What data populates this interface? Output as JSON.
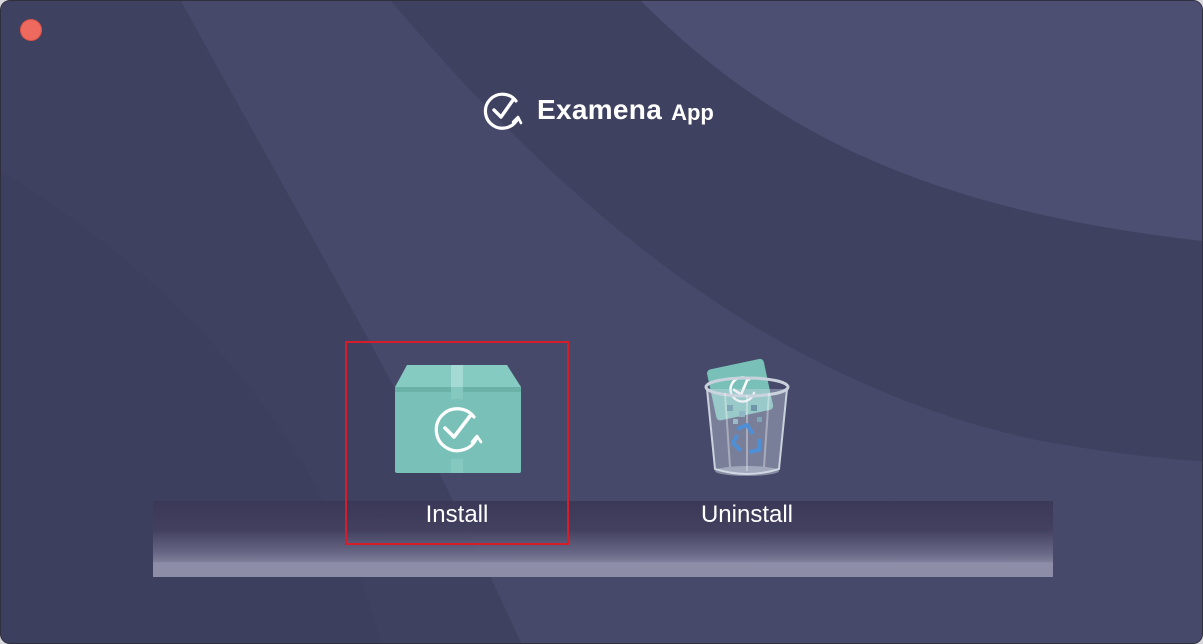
{
  "window": {
    "close_button": "close",
    "background_colors": [
      "#3f4160",
      "#474a6c",
      "#4e5275"
    ]
  },
  "logo": {
    "icon": "check-circle-refresh-icon",
    "name": "Examena",
    "suffix": "App"
  },
  "actions": [
    {
      "label": "Install",
      "icon": "package-box-icon",
      "selected": true
    },
    {
      "label": "Uninstall",
      "icon": "trash-bin-icon",
      "selected": false
    }
  ],
  "colors": {
    "accent": "#7cc4bb",
    "selection_outline": "#d71d2a",
    "close": "#ee6a5e"
  }
}
